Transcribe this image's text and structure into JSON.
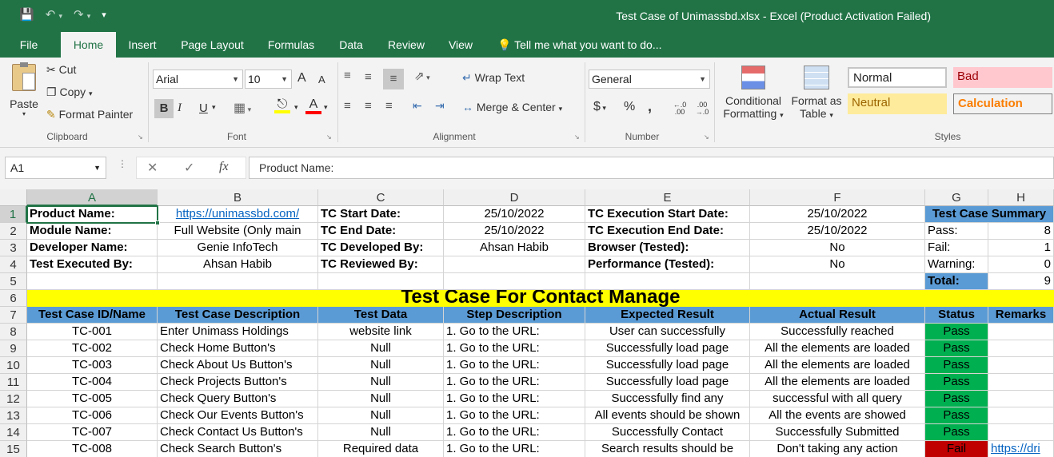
{
  "window": {
    "title": "Test Case of Unimassbd.xlsx - Excel (Product Activation Failed)",
    "save_icon": "save-icon",
    "undo_icon": "undo-icon",
    "redo_icon": "redo-icon",
    "customize_icon": "customize-qat-icon"
  },
  "tabs": [
    "File",
    "Home",
    "Insert",
    "Page Layout",
    "Formulas",
    "Data",
    "Review",
    "View"
  ],
  "active_tab": "Home",
  "tell_me": "Tell me what you want to do...",
  "ribbon": {
    "clipboard": {
      "paste": "Paste",
      "cut": "Cut",
      "copy": "Copy",
      "format_painter": "Format Painter",
      "label": "Clipboard"
    },
    "font": {
      "name": "Arial",
      "size": "10",
      "bold": "B",
      "italic": "I",
      "underline": "U",
      "grow": "A",
      "shrink": "A",
      "label": "Font"
    },
    "alignment": {
      "wrap_text": "Wrap Text",
      "merge_center": "Merge & Center",
      "label": "Alignment"
    },
    "number": {
      "format": "General",
      "currency": "$",
      "percent": "%",
      "comma": ",",
      "inc_dec": "←.0 .00",
      "dec_dec": ".00 →.0",
      "label": "Number"
    },
    "styles": {
      "conditional": [
        "Conditional",
        "Formatting"
      ],
      "format_table": [
        "Format as",
        "Table"
      ],
      "normal": "Normal",
      "bad": "Bad",
      "neutral": "Neutral",
      "calculation": "Calculation",
      "label": "Styles"
    }
  },
  "formula_bar": {
    "name_box": "A1",
    "fx": "fx",
    "content": "Product Name:"
  },
  "columns": [
    "A",
    "B",
    "C",
    "D",
    "E",
    "F",
    "G",
    "H"
  ],
  "rows": [
    "1",
    "2",
    "3",
    "4",
    "5",
    "6",
    "7",
    "8",
    "9",
    "10",
    "11",
    "12",
    "13",
    "14",
    "15"
  ],
  "info": {
    "r1": [
      "Product Name:",
      "https://unimassbd.com/",
      "TC Start Date:",
      "25/10/2022",
      "TC Execution Start Date:",
      "25/10/2022",
      "Test Case Summary"
    ],
    "r2": [
      "Module Name:",
      "Full Website (Only main",
      "TC End Date:",
      "25/10/2022",
      "TC Execution End Date:",
      "25/10/2022",
      "Pass:",
      "8"
    ],
    "r3": [
      "Developer Name:",
      "Genie InfoTech",
      "TC Developed By:",
      "Ahsan Habib",
      "Browser (Tested):",
      "No",
      "Fail:",
      "1"
    ],
    "r4": [
      "Test Executed By:",
      "Ahsan Habib",
      "TC Reviewed By:",
      "",
      "Performance (Tested):",
      "No",
      "Warning:",
      "0"
    ],
    "r5": [
      "Total:",
      "9"
    ]
  },
  "banner": "Test Case For Contact Manage",
  "table": {
    "headers": [
      "Test Case ID/Name",
      "Test Case Description",
      "Test Data",
      "Step Description",
      "Expected Result",
      "Actual Result",
      "Status",
      "Remarks"
    ],
    "rows": [
      [
        "TC-001",
        "Enter Unimass Holdings",
        "website link",
        "1. Go to the URL:",
        "User can successfully",
        "Successfully reached",
        "Pass",
        ""
      ],
      [
        "TC-002",
        "Check Home Button's",
        "Null",
        "1. Go to the URL:",
        "Successfully load page",
        "All the  elements are loaded",
        "Pass",
        ""
      ],
      [
        "TC-003",
        "Check About Us Button's",
        "Null",
        "1. Go to the URL:",
        "Successfully load page",
        "All the  elements are loaded",
        "Pass",
        ""
      ],
      [
        "TC-004",
        "Check Projects Button's",
        "Null",
        "1. Go to the URL:",
        "Successfully load page",
        "All the  elements are loaded",
        "Pass",
        ""
      ],
      [
        "TC-005",
        "Check Query Button's",
        "Null",
        "1. Go to the URL:",
        "Successfully find any",
        "successful with all query",
        "Pass",
        ""
      ],
      [
        "TC-006",
        "Check Our Events Button's",
        "Null",
        "1. Go to the URL:",
        "All events should be shown",
        "All the events are showed",
        "Pass",
        ""
      ],
      [
        "TC-007",
        "Check Contact Us Button's",
        "Null",
        "1. Go to the URL:",
        "Successfully Contact",
        "Successfully Submitted",
        "Pass",
        ""
      ],
      [
        "TC-008",
        "Check Search Button's",
        "Required data",
        "1. Go to the URL:",
        "Search results should be",
        "Don't taking any action",
        "Fail",
        "https://dri"
      ]
    ]
  },
  "colors": {
    "excel_green": "#217346",
    "header_blue": "#5b9bd5",
    "banner_yellow": "#ffff00",
    "pass_green": "#00b050",
    "fail_red": "#c00000"
  }
}
